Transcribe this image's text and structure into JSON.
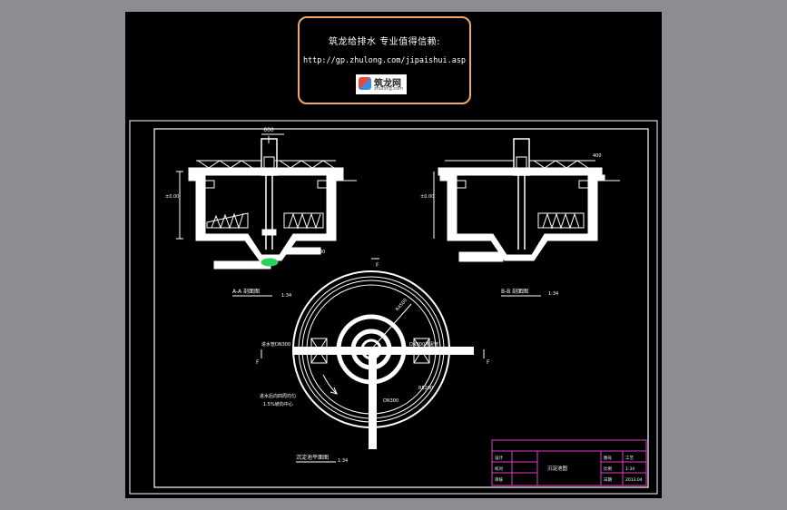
{
  "banner": {
    "line1": "筑龙给排水 专业值得信赖:",
    "line2": "http://gp.zhulong.com/jipaishui.asp",
    "logo_text": "筑龙网",
    "logo_sub": "zhulong.com"
  },
  "drawing": {
    "section_aa_title": "A-A 剖面图",
    "section_bb_title": "B-B 剖面图",
    "plan_title": "沉淀池平面图",
    "scale": "1:34",
    "labels": {
      "top_dim": "600",
      "dim_b": "400",
      "elev_left": "±0.00",
      "elev_right": "±0.00",
      "inlet_pipe": "进水管DN300",
      "outlet_pipe": "出水管DN300",
      "plan_inlet": "进水管DN300",
      "plan_outlet": "DN300排泥管",
      "plan_radius": "R4500",
      "plan_center": "DN300",
      "plan_arrow_note1": "进水后向四周均匀",
      "plan_arrow_note2": "1.5%坡向中心",
      "plan_dim_right": "R5200",
      "mark_A": "A",
      "mark_B": "B",
      "mark_F": "F"
    }
  },
  "title_block": {
    "cells": [
      "设计",
      "校对",
      "审核",
      "",
      "沉淀池图",
      "图号",
      "比例",
      "日期",
      "工艺",
      "1:34",
      "01",
      "2013.04"
    ]
  }
}
